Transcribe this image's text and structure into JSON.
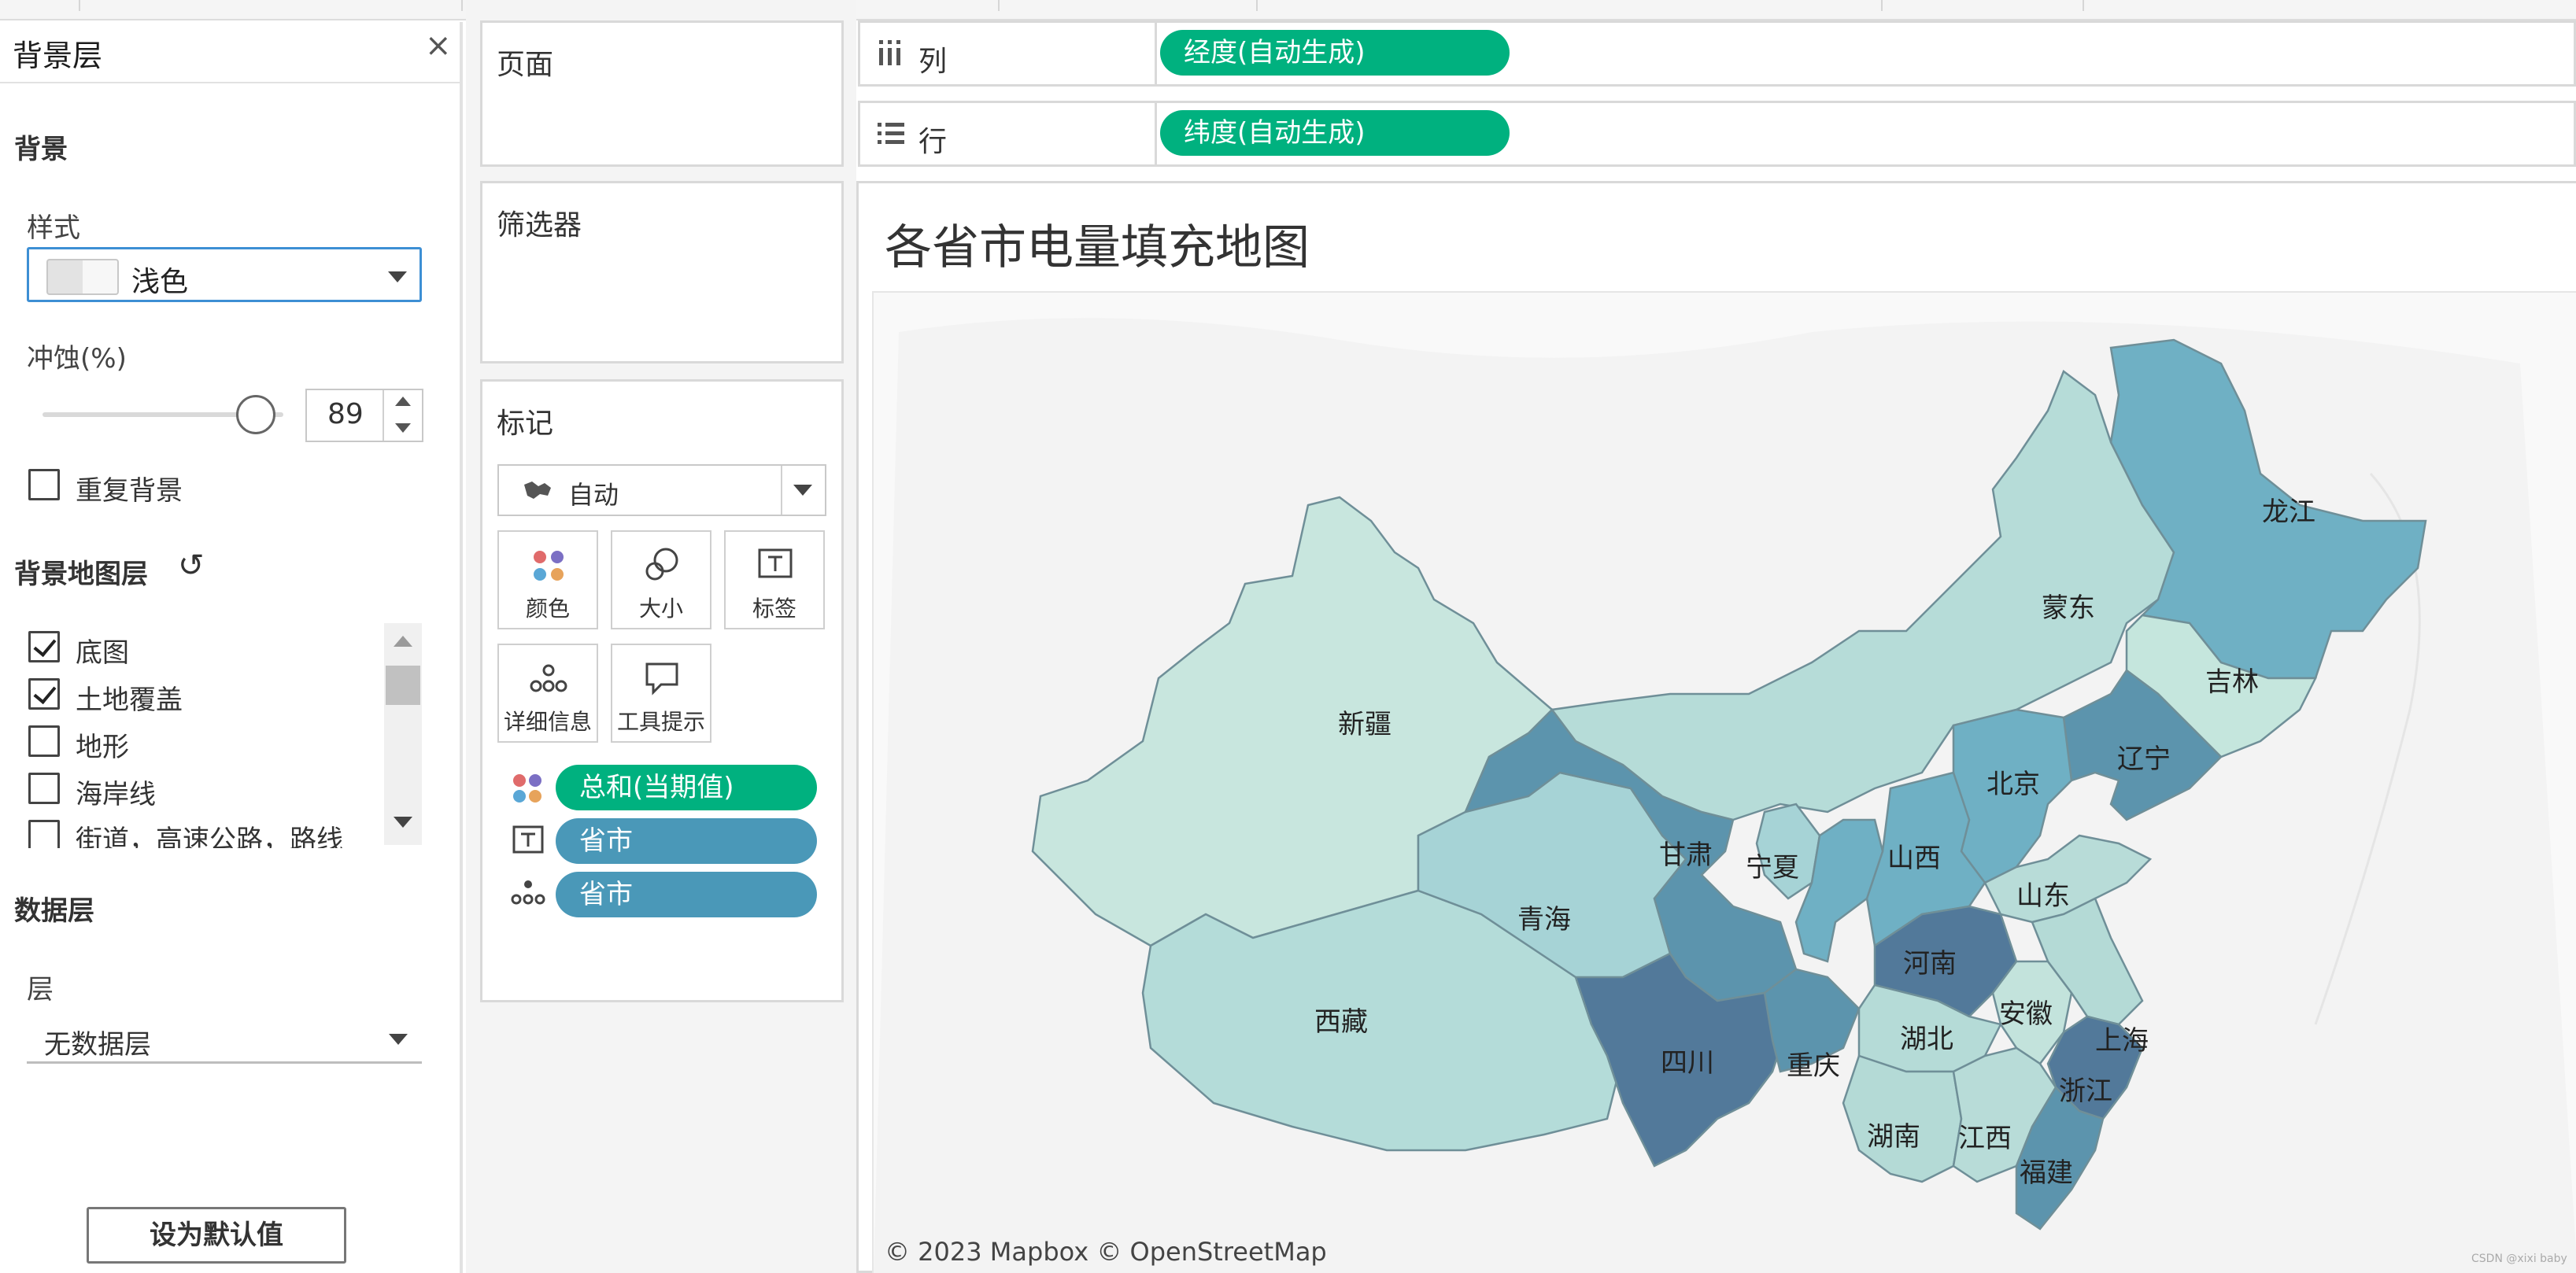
{
  "background_panel": {
    "title": "背景层",
    "close_glyph": "×",
    "background_header": "背景",
    "style_label": "样式",
    "style_value": "浅色",
    "washout_label": "冲蚀(%)",
    "washout_value": "89",
    "repeat_label": "重复背景",
    "map_layers_header": "背景地图层",
    "reset_glyph": "↺",
    "layers": [
      {
        "label": "底图",
        "checked": true
      },
      {
        "label": "土地覆盖",
        "checked": true
      },
      {
        "label": "地形",
        "checked": false
      },
      {
        "label": "海岸线",
        "checked": false
      },
      {
        "label": "街道，高速公路，路线",
        "checked": false
      }
    ],
    "data_layer_header": "数据层",
    "layer_label": "层",
    "layer_value": "无数据层",
    "default_button": "设为默认值"
  },
  "pages_panel": {
    "title": "页面"
  },
  "filters_panel": {
    "title": "筛选器"
  },
  "marks_panel": {
    "title": "标记",
    "mark_type": "自动",
    "buttons": [
      "颜色",
      "大小",
      "标签",
      "详细信息",
      "工具提示"
    ],
    "pills": [
      "总和(当期值)",
      "省市",
      "省市"
    ]
  },
  "shelves": {
    "columns_label": "列",
    "columns_pill": "经度(自动生成)",
    "rows_label": "行",
    "rows_pill": "纬度(自动生成)"
  },
  "view": {
    "title": "各省市电量填充地图",
    "copyright": "© 2023 Mapbox © OpenStreetMap",
    "watermark": "CSDN @xixi baby"
  },
  "map_labels": {
    "heilongjiang": "龙江",
    "mengdong": "蒙东",
    "jilin": "吉林",
    "liaoning": "辽宁",
    "beijing": "北京",
    "xinjiang": "新疆",
    "gansu": "甘肃",
    "ningxia": "宁夏",
    "shanxi": "山西",
    "shandong": "山东",
    "qinghai": "青海",
    "henan": "河南",
    "xizang": "西藏",
    "sichuan": "四川",
    "chongqing": "重庆",
    "hubei": "湖北",
    "anhui": "安徽",
    "shanghai": "上海",
    "zhejiang": "浙江",
    "hunan": "湖南",
    "jiangxi": "江西",
    "fujian": "福建"
  },
  "colors": {
    "accent_green": "#00b17f",
    "pill_blue": "#4a98b8",
    "fill_darkest": "#52799a",
    "fill_dark": "#5c94ad",
    "fill_mid": "#6fb0c4",
    "fill_light": "#a6d3d6",
    "fill_lightest": "#c8e6de"
  }
}
